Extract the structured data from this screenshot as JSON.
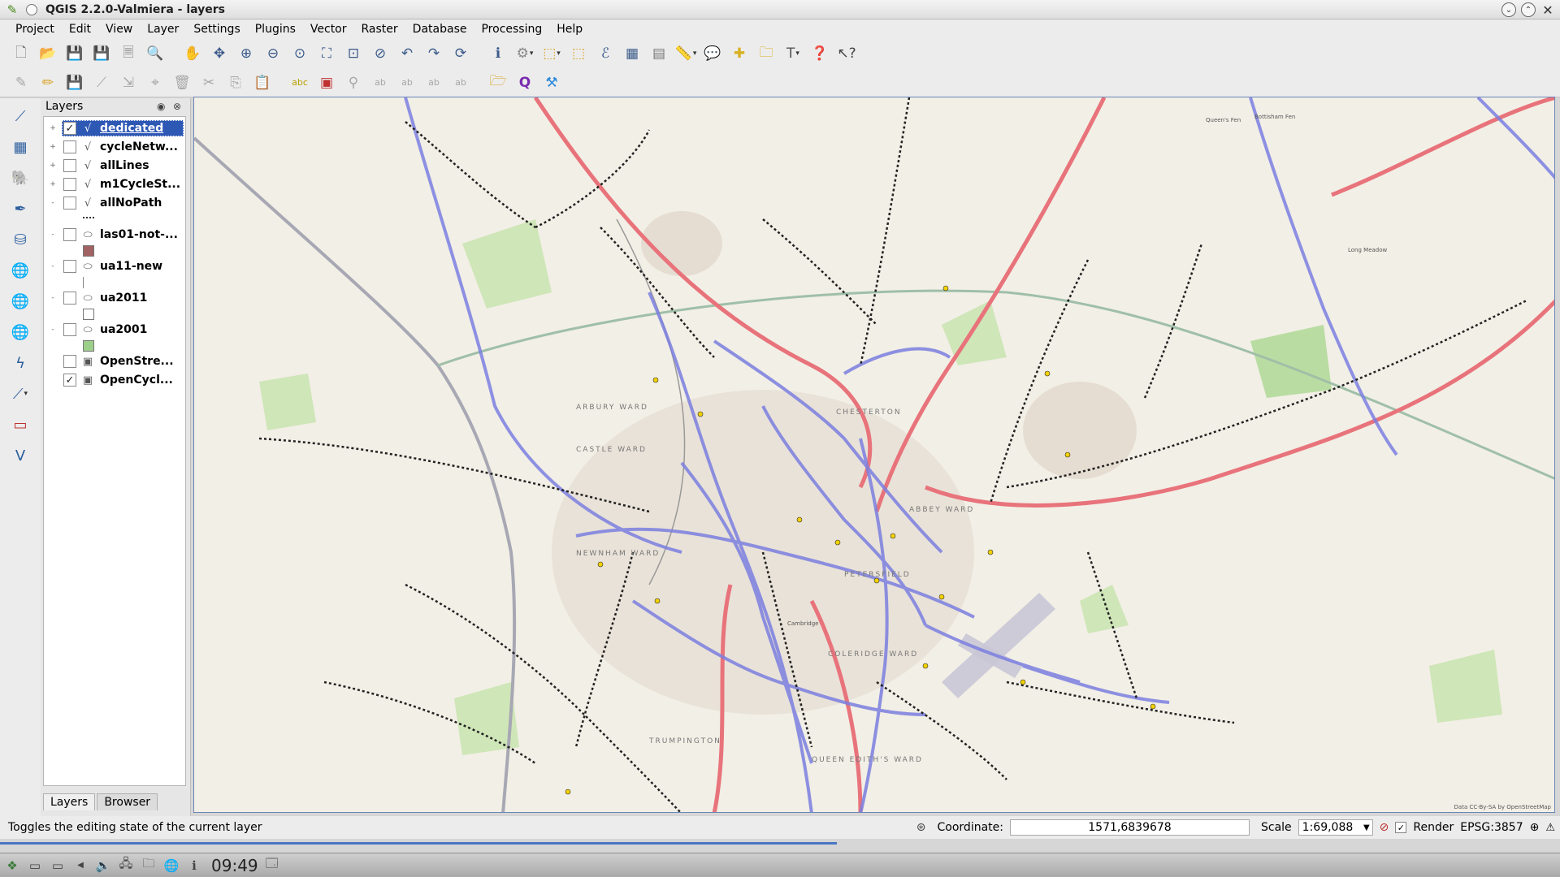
{
  "window": {
    "title": "QGIS 2.2.0-Valmiera - layers"
  },
  "menu": [
    "Project",
    "Edit",
    "View",
    "Layer",
    "Settings",
    "Plugins",
    "Vector",
    "Raster",
    "Database",
    "Processing",
    "Help"
  ],
  "panel": {
    "title": "Layers",
    "layers": [
      {
        "name": "dedicated",
        "type": "line",
        "checked": true,
        "selected": true,
        "expander": "+"
      },
      {
        "name": "cycleNetw...",
        "type": "line",
        "checked": false,
        "selected": false,
        "expander": "+"
      },
      {
        "name": "allLines",
        "type": "line",
        "checked": false,
        "selected": false,
        "expander": "+"
      },
      {
        "name": "m1CycleSt...",
        "type": "line",
        "checked": false,
        "selected": false,
        "expander": "+"
      },
      {
        "name": "allNoPath",
        "type": "line",
        "checked": false,
        "selected": false,
        "expander": "-"
      },
      {
        "name": "las01-not-...",
        "type": "polygon",
        "checked": false,
        "selected": false,
        "expander": "-"
      },
      {
        "name": "ua11-new",
        "type": "polygon",
        "checked": false,
        "selected": false,
        "expander": "-"
      },
      {
        "name": "ua2011",
        "type": "polygon",
        "checked": false,
        "selected": false,
        "expander": "-"
      },
      {
        "name": "ua2001",
        "type": "polygon",
        "checked": false,
        "selected": false,
        "expander": "-"
      },
      {
        "name": "OpenStre...",
        "type": "raster",
        "checked": false,
        "selected": false,
        "expander": ""
      },
      {
        "name": "OpenCycl...",
        "type": "raster",
        "checked": true,
        "selected": false,
        "expander": ""
      }
    ],
    "tabs": [
      "Layers",
      "Browser"
    ]
  },
  "map": {
    "attribution": "Data CC-By-SA by OpenStreetMap",
    "labels": [
      "ARBURY WARD",
      "CASTLE WARD",
      "NEWNHAM WARD",
      "CHESTERTON",
      "ABBEY WARD",
      "COLERIDGE WARD",
      "TRUMPINGTON",
      "QUEEN EDITH'S WARD",
      "PETERSFIELD",
      "Cambridge",
      "Long Meadow",
      "Queen's Fen",
      "Bottisham Fen"
    ]
  },
  "status": {
    "message": "Toggles the editing state of the current layer",
    "coordinate_label": "Coordinate:",
    "coordinate_value": "1571,6839678",
    "scale_label": "Scale",
    "scale_value": "1:69,088",
    "render_label": "Render",
    "render_checked": true,
    "crs": "EPSG:3857"
  },
  "taskbar": {
    "clock": "09:49"
  },
  "colors": {
    "selection": "#2d58b4",
    "route_blue": "#7b7fe0",
    "route_red": "#e8737b",
    "map_bg": "#f2efe6"
  }
}
